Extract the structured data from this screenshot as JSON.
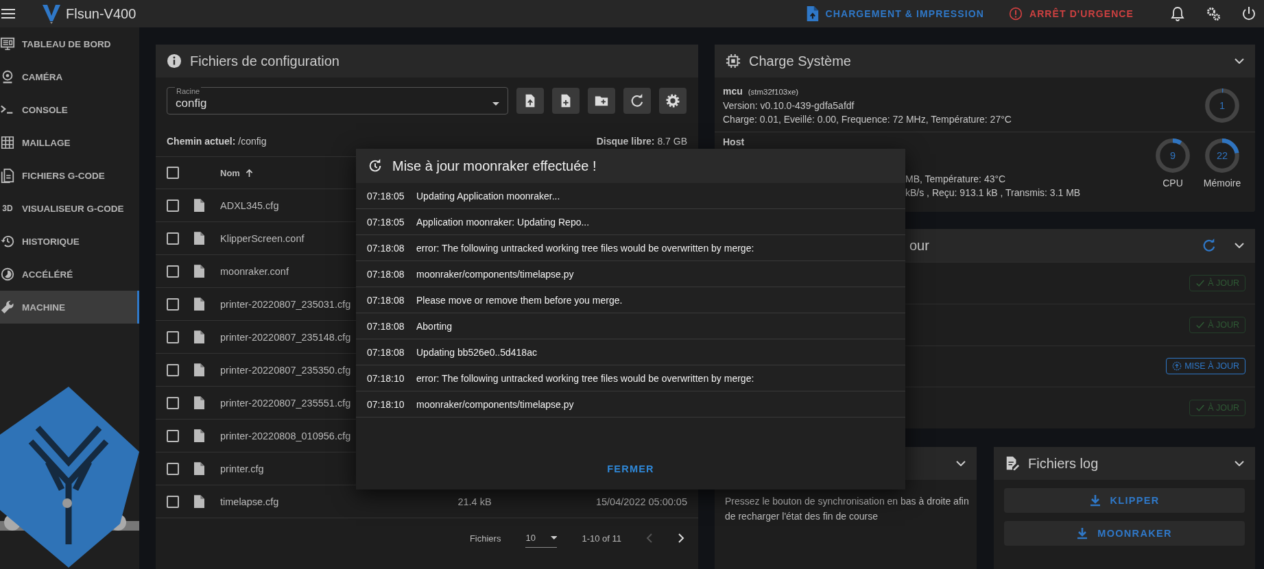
{
  "app_bar": {
    "title": "Flsun-V400",
    "actions": [
      {
        "kind": "upload",
        "label": "CHARGEMENT & IMPRESSION"
      },
      {
        "kind": "emergency",
        "label": "ARRÊT D'URGENCE"
      }
    ]
  },
  "sidebar": {
    "items": [
      {
        "kind": "dashboard",
        "label": "TABLEAU DE BORD",
        "selected": false
      },
      {
        "kind": "camera",
        "label": "CAMÉRA",
        "selected": false
      },
      {
        "kind": "console",
        "label": "CONSOLE",
        "selected": false
      },
      {
        "kind": "mesh",
        "label": "MAILLAGE",
        "selected": false
      },
      {
        "kind": "files",
        "label": "FICHIERS G-CODE",
        "selected": false
      },
      {
        "kind": "viewer",
        "glyph": "3D",
        "label": "VISUALISEUR G-CODE",
        "selected": false
      },
      {
        "kind": "history",
        "label": "HISTORIQUE",
        "selected": false
      },
      {
        "kind": "timelapse",
        "label": "ACCÉLÉRÉ",
        "selected": false
      },
      {
        "kind": "machine",
        "label": "MACHINE",
        "selected": true
      }
    ]
  },
  "config_files": {
    "title": "Fichiers de configuration",
    "root": {
      "label": "Racine",
      "value": "config"
    },
    "path_label": "Chemin actuel:",
    "path": "/config",
    "disk_label": "Disque libre:",
    "disk": "8.7 GB",
    "header_checked": false,
    "columns": [
      {
        "label": "Nom"
      }
    ],
    "rows": [
      {
        "name": "ADXL345.cfg",
        "selected": false
      },
      {
        "name": "KlipperScreen.conf",
        "selected": false
      },
      {
        "name": "moonraker.conf",
        "selected": false
      },
      {
        "name": "printer-20220807_235031.cfg",
        "selected": false
      },
      {
        "name": "printer-20220807_235148.cfg",
        "selected": false
      },
      {
        "name": "printer-20220807_235350.cfg",
        "selected": false
      },
      {
        "name": "printer-20220807_235551.cfg",
        "selected": false
      },
      {
        "name": "printer-20220808_010956.cfg",
        "selected": false
      },
      {
        "name": "printer.cfg",
        "selected": false
      },
      {
        "name": "timelapse.cfg",
        "selected": false,
        "size": "21.4 kB",
        "modified": "15/04/2022 05:00:05"
      }
    ],
    "pagination": {
      "label": "Fichiers",
      "per_page": "10",
      "range": "1-10 of 11"
    }
  },
  "system_load": {
    "title": "Charge Système",
    "mcu": {
      "name": "mcu",
      "chip": "(stm32f103xe)",
      "version": "Version: v0.10.0-439-gdfa5afdf",
      "stats": "Charge: 0.01, Eveillé: 0.00, Frequence: 72 MHz, Température: 27°C",
      "gauges": [
        {
          "value": "1",
          "level": 0.01
        }
      ]
    },
    "host": {
      "name": "Host",
      "lines": [
        "MB, Température: 43°C",
        "kB/s , Reçu: 913.1 kB , Transmis: 3.1 MB"
      ],
      "gauges": [
        {
          "value": "9",
          "label": "CPU",
          "level": 0.09
        },
        {
          "value": "22",
          "label": "Mémoire",
          "level": 0.22
        }
      ]
    }
  },
  "updates": {
    "title": "our",
    "rows": [
      {
        "kind": "current",
        "label": "À JOUR"
      },
      {
        "kind": "current",
        "label": "À JOUR"
      },
      {
        "kind": "update",
        "label": "MISE À JOUR"
      },
      {
        "kind": "current",
        "label": "À JOUR"
      }
    ]
  },
  "endstops": {
    "text": "Pressez le bouton de synchronisation en bas à droite afin de recharger l'état des fin de course"
  },
  "logs": {
    "title": "Fichiers log",
    "buttons": [
      "KLIPPER",
      "MOONRAKER"
    ]
  },
  "dialog": {
    "title": "Mise à jour moonraker effectuée !",
    "entries": [
      {
        "time": "07:18:05",
        "message": "Updating Application moonraker..."
      },
      {
        "time": "07:18:05",
        "message": "Application moonraker: Updating Repo..."
      },
      {
        "time": "07:18:08",
        "message": "error: The following untracked working tree files would be overwritten by merge:"
      },
      {
        "time": "07:18:08",
        "message": "moonraker/components/timelapse.py"
      },
      {
        "time": "07:18:08",
        "message": "Please move or remove them before you merge."
      },
      {
        "time": "07:18:08",
        "message": "Aborting"
      },
      {
        "time": "07:18:08",
        "message": "Updating bb526e0..5d418ac"
      },
      {
        "time": "07:18:10",
        "message": "error: The following untracked working tree files would be overwritten by merge:"
      },
      {
        "time": "07:18:10",
        "message": "moonraker/components/timelapse.py"
      }
    ],
    "close": "FERMER"
  }
}
